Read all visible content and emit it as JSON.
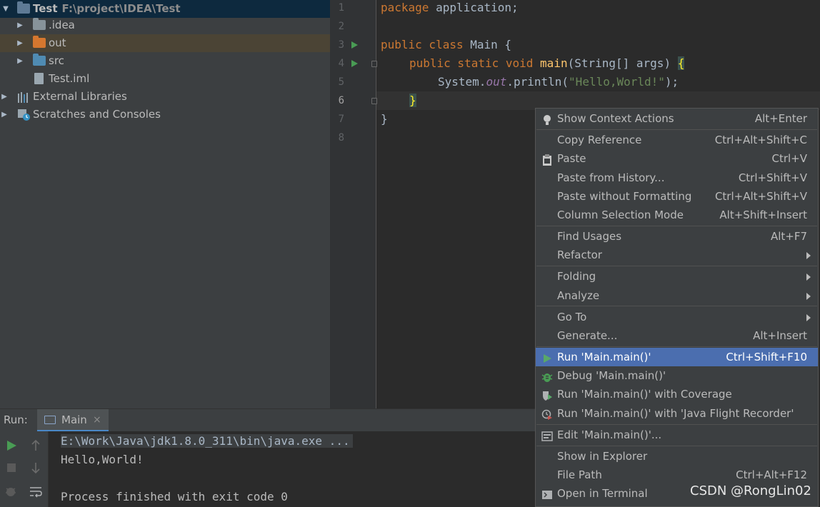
{
  "project": {
    "root": {
      "name": "Test",
      "path": "F:\\project\\IDEA\\Test"
    },
    "items": [
      {
        "label": ".idea"
      },
      {
        "label": "out"
      },
      {
        "label": "src"
      },
      {
        "label": "Test.iml"
      },
      {
        "label": "External Libraries"
      },
      {
        "label": "Scratches and Consoles"
      }
    ]
  },
  "editor": {
    "line_numbers": [
      "1",
      "2",
      "3",
      "4",
      "5",
      "6",
      "7",
      "8"
    ],
    "tokens": {
      "package_kw": "package",
      "package_name": " application;",
      "public_kw": "public",
      "class_kw": " class",
      "class_name": " Main {",
      "m_public": "public",
      "m_static": " static",
      "m_void": " void",
      "m_name": "main",
      "m_params": "(String[] args) ",
      "m_brace": "{",
      "sys": "System.",
      "out": "out",
      "println": ".println(",
      "str": "\"Hello,World!\"",
      "end": ");",
      "close_brace": "}",
      "class_close": "}"
    }
  },
  "run": {
    "label": "Run:",
    "tab": "Main",
    "tab_close": "×",
    "console": [
      "E:\\Work\\Java\\jdk1.8.0_311\\bin\\java.exe ...",
      "Hello,World!",
      "",
      "Process finished with exit code 0"
    ]
  },
  "menu": {
    "items": [
      {
        "label": "Show Context Actions",
        "shortcut": "Alt+Enter"
      },
      {
        "label": "Copy Reference",
        "shortcut": "Ctrl+Alt+Shift+C"
      },
      {
        "label": "Paste",
        "shortcut": "Ctrl+V"
      },
      {
        "label": "Paste from History...",
        "shortcut": "Ctrl+Shift+V"
      },
      {
        "label": "Paste without Formatting",
        "shortcut": "Ctrl+Alt+Shift+V"
      },
      {
        "label": "Column Selection Mode",
        "shortcut": "Alt+Shift+Insert"
      },
      {
        "label": "Find Usages",
        "shortcut": "Alt+F7"
      },
      {
        "label": "Refactor",
        "shortcut": ""
      },
      {
        "label": "Folding",
        "shortcut": ""
      },
      {
        "label": "Analyze",
        "shortcut": ""
      },
      {
        "label": "Go To",
        "shortcut": ""
      },
      {
        "label": "Generate...",
        "shortcut": "Alt+Insert"
      },
      {
        "label": "Run 'Main.main()'",
        "shortcut": "Ctrl+Shift+F10"
      },
      {
        "label": "Debug 'Main.main()'",
        "shortcut": ""
      },
      {
        "label": "Run 'Main.main()' with Coverage",
        "shortcut": ""
      },
      {
        "label": "Run 'Main.main()' with 'Java Flight Recorder'",
        "shortcut": ""
      },
      {
        "label": "Edit 'Main.main()'...",
        "shortcut": ""
      },
      {
        "label": "Show in Explorer",
        "shortcut": ""
      },
      {
        "label": "File Path",
        "shortcut": "Ctrl+Alt+F12"
      },
      {
        "label": "Open in Terminal",
        "shortcut": ""
      }
    ]
  },
  "watermark": "CSDN @RongLin02"
}
